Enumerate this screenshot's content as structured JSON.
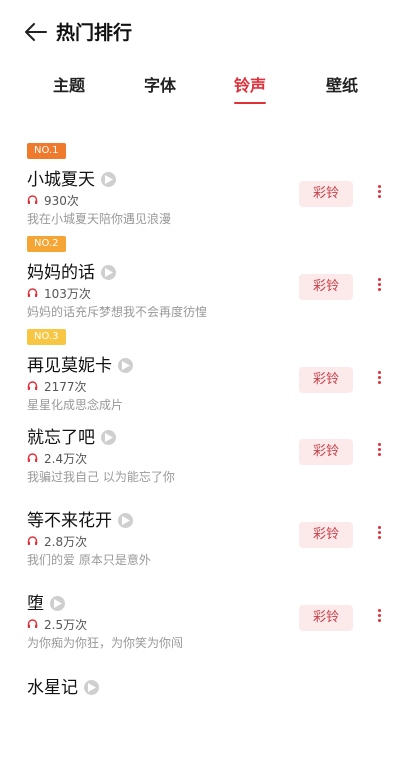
{
  "header": {
    "title": "热门排行"
  },
  "tabs": [
    {
      "label": "主题"
    },
    {
      "label": "字体"
    },
    {
      "label": "铃声"
    },
    {
      "label": "壁纸"
    }
  ],
  "colors": {
    "accent": "#e0303a",
    "badge1": "#f07a2c",
    "badge2": "#f5a533",
    "badge3": "#f7c744"
  },
  "ring_button_label": "彩铃",
  "items": [
    {
      "rank": "NO.1",
      "title": "小城夏天",
      "count": "930次",
      "desc": "我在小城夏天陪你遇见浪漫"
    },
    {
      "rank": "NO.2",
      "title": "妈妈的话",
      "count": "103万次",
      "desc": "妈妈的话充斥梦想我不会再度彷惶"
    },
    {
      "rank": "NO.3",
      "title": "再见莫妮卡",
      "count": "2177次",
      "desc": "星星化成思念成片"
    },
    {
      "rank": "",
      "title": "就忘了吧",
      "count": "2.4万次",
      "desc": "我骗过我自己 以为能忘了你"
    },
    {
      "rank": "",
      "title": "等不来花开",
      "count": "2.8万次",
      "desc": "我们的爱 原本只是意外"
    },
    {
      "rank": "",
      "title": "堕",
      "count": "2.5万次",
      "desc": "为你痴为你狂，为你笑为你闯"
    },
    {
      "rank": "",
      "title": "水星记",
      "count": "",
      "desc": ""
    }
  ]
}
